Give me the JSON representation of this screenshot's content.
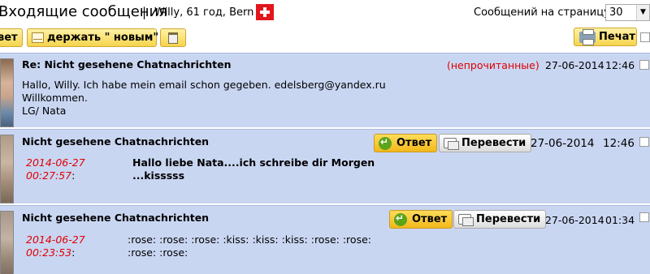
{
  "header": {
    "title": "Входящие сообщения",
    "separator": "|",
    "user_info": "Willy, 61 год, Bern",
    "flag_icon": "swiss-flag",
    "per_page_label": "Сообщений на страницу:",
    "per_page_value": "30"
  },
  "toolbar": {
    "reply_label": "вет",
    "keep_new_label": "держать \" новым\"",
    "print_label": "Печат"
  },
  "messages": [
    {
      "subject": "Re: Nicht gesehene Chatnachrichten",
      "status": "(непрочитанные)",
      "date": "27-06-2014",
      "time": "12:46",
      "body": [
        "Hallo, Willy. Ich habe mein email schon gegeben. edelsberg@yandex.ru",
        "Willkommen.",
        "LG/ Nata"
      ]
    },
    {
      "subject": "Nicht gesehene Chatnachrichten",
      "answer_label": "Ответ",
      "translate_label": "Перевести",
      "date": "27-06-2014",
      "time": "12:46",
      "log": {
        "date": "2014-06-27",
        "time": "00:27:57",
        "colon": ":",
        "lines": [
          "Hallo liebe Nata....ich schreibe dir Morgen",
          "...kisssss"
        ]
      }
    },
    {
      "subject": "Nicht gesehene Chatnachrichten",
      "answer_label": "Ответ",
      "translate_label": "Перевести",
      "date": "27-06-2014",
      "time": "01:34",
      "log": {
        "date": "2014-06-27",
        "time": "00:23:53",
        "colon": ":",
        "lines": [
          ":rose: :rose: :rose: :kiss: :kiss: :kiss: :rose: :rose:",
          ":rose: :rose:"
        ]
      }
    }
  ]
}
